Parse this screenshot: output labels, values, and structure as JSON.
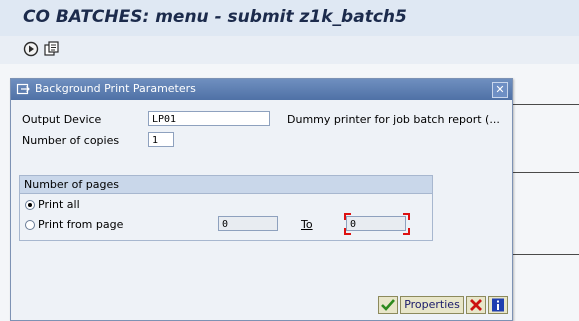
{
  "app": {
    "title": "CO BATCHES: menu - submit z1k_batch5"
  },
  "toolbar": {
    "icons": [
      "execute-icon",
      "variant-icon"
    ]
  },
  "dialog": {
    "title": "Background Print Parameters",
    "output_device": {
      "label": "Output Device",
      "value": "LP01",
      "description": "Dummy printer for job batch report (..."
    },
    "copies": {
      "label": "Number of copies",
      "value": "1"
    },
    "pages": {
      "title": "Number of pages",
      "print_all": {
        "label": "Print all",
        "selected": true
      },
      "print_from": {
        "label": "Print from page",
        "selected": false,
        "from_value": "0",
        "to_label": "To",
        "to_value": "0"
      }
    },
    "buttons": {
      "continue_icon": "checkmark-icon",
      "properties": "Properties",
      "cancel_icon": "cancel-icon",
      "info_icon": "info-icon"
    }
  },
  "colors": {
    "title_text": "#1c2b4c",
    "dialog_header": "#4f71a6",
    "button_face": "#e8e6c9",
    "required_marker": "#dd1111"
  }
}
